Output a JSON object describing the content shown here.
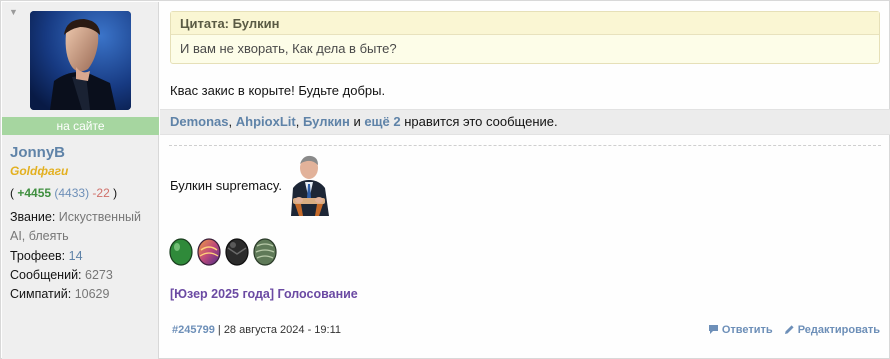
{
  "user": {
    "online_label": "на сайте",
    "name": "JonnyB",
    "title": "Goldфаги",
    "rep_open": "(",
    "rep_positive": "+4455",
    "rep_total": "(4433)",
    "rep_negative": "-22",
    "rep_close": ")",
    "rank_label": "Звание:",
    "rank_value": "Искуственный AI, блеять",
    "trophies_label": "Трофеев:",
    "trophies_value": "14",
    "messages_label": "Сообщений:",
    "messages_value": "6273",
    "likes_label": "Симпатий:",
    "likes_value": "10629"
  },
  "quote": {
    "header": "Цитата: Булкин",
    "text": "И вам не хворать, Как дела в быте?"
  },
  "message": {
    "text": "Квас закис в корыте! Будьте добры."
  },
  "likes_bar": {
    "user1": "Demonas",
    "sep1": ",",
    "user2": "AhpioxLit",
    "sep2": ",",
    "user3": "Булкин",
    "and_word": "и",
    "more": "ещё 2",
    "suffix": "нравится это сообщение."
  },
  "signature": {
    "text": "Булкин supremacy.",
    "link": "[Юзер 2025 года] Голосование"
  },
  "footer": {
    "post_id": "#245799",
    "separator": "|",
    "date": "28 августа 2024 - 19:11",
    "reply_label": "Ответить",
    "edit_label": "Редактировать"
  },
  "colors": {
    "online": "#a6d6a0",
    "username": "#5f83a8",
    "user_title": "#e3b020",
    "vote_link": "#6b4aa3"
  }
}
